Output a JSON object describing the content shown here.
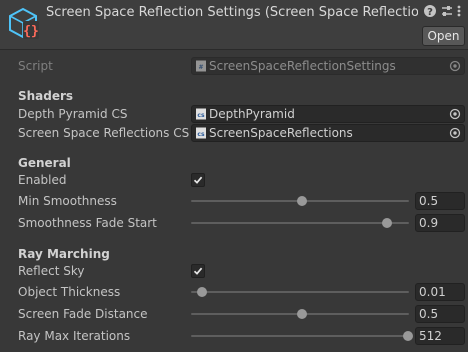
{
  "header": {
    "title": "Screen Space Reflection Settings (Screen Space Reflection",
    "asset_icon": "scriptable-object-icon",
    "help_icon": "help-icon",
    "presets_icon": "presets-icon",
    "menu_icon": "kebab-menu-icon",
    "open_label": "Open"
  },
  "script_field": {
    "label": "Script",
    "value": "ScreenSpaceReflectionSettings"
  },
  "shaders": {
    "title": "Shaders",
    "depth_pyramid": {
      "label": "Depth Pyramid CS",
      "value": "DepthPyramid"
    },
    "ssr": {
      "label": "Screen Space Reflections CS",
      "value": "ScreenSpaceReflections"
    }
  },
  "general": {
    "title": "General",
    "enabled": {
      "label": "Enabled",
      "checked": true
    },
    "min_smoothness": {
      "label": "Min Smoothness",
      "value": "0.5",
      "fraction": 0.5
    },
    "smoothness_fade_start": {
      "label": "Smoothness Fade Start",
      "value": "0.9",
      "fraction": 0.9
    }
  },
  "ray_marching": {
    "title": "Ray Marching",
    "reflect_sky": {
      "label": "Reflect Sky",
      "checked": true
    },
    "object_thickness": {
      "label": "Object Thickness",
      "value": "0.01",
      "fraction": 0.03
    },
    "screen_fade_distance": {
      "label": "Screen Fade Distance",
      "value": "0.5",
      "fraction": 0.5
    },
    "ray_max_iterations": {
      "label": "Ray Max Iterations",
      "value": "512",
      "fraction": 1.0
    }
  },
  "colors": {
    "background": "#383838",
    "field": "#2a2a2a",
    "thumb": "#999999",
    "accent": "#4fc3f7"
  }
}
